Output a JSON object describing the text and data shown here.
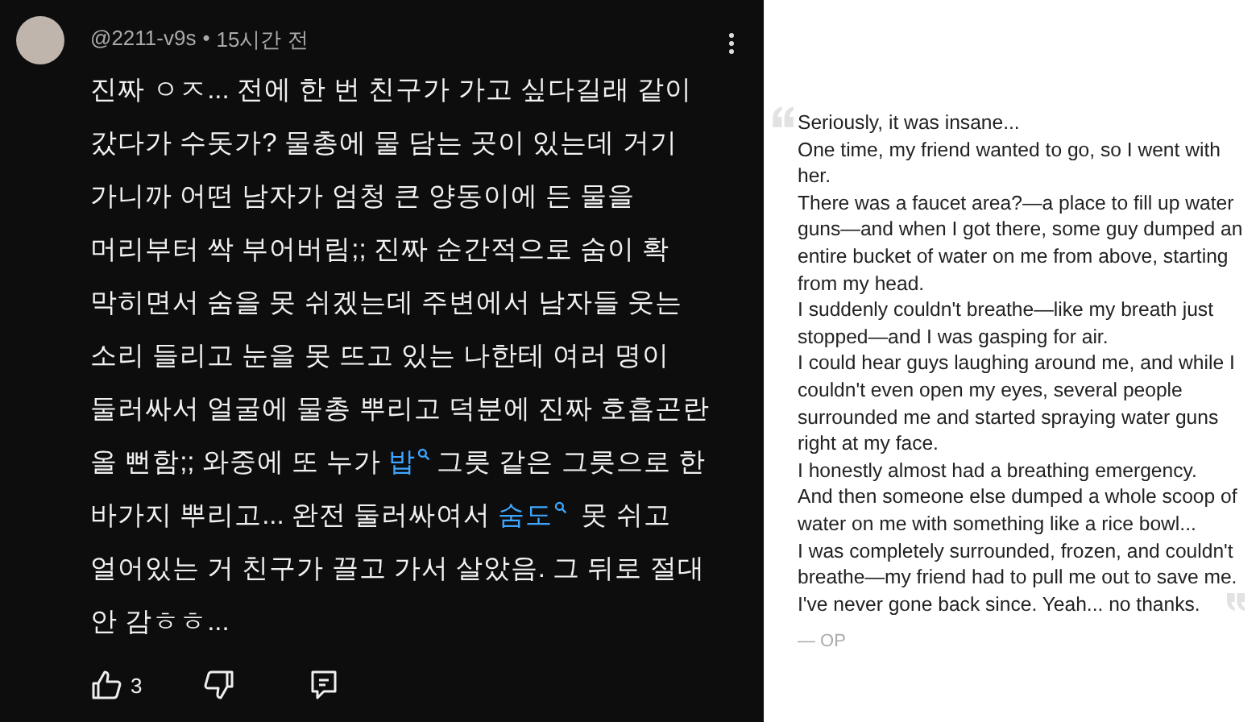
{
  "comment": {
    "author": "@2211-v9s",
    "separator": "•",
    "time": "15시간 전",
    "lines": [
      [
        {
          "kind": "plain",
          "text": "진짜 ㅇㅈ... 전에 한 번 친구가 가고 싶다길래 같이"
        }
      ],
      [
        {
          "kind": "plain",
          "text": "갔다가 수돗가? 물총에 물 담는 곳이 있는데 거기"
        }
      ],
      [
        {
          "kind": "plain",
          "text": "가니까 어떤 남자가 엄청 큰 양동이에 든 물을"
        }
      ],
      [
        {
          "kind": "plain",
          "text": "머리부터 싹 부어버림;; 진짜 순간적으로 숨이 확"
        }
      ],
      [
        {
          "kind": "plain",
          "text": "막히면서 숨을 못 쉬겠는데 주변에서 남자들 웃는"
        }
      ],
      [
        {
          "kind": "plain",
          "text": "소리 들리고 눈을 못 뜨고 있는 나한테 여러 명이"
        }
      ],
      [
        {
          "kind": "plain",
          "text": "둘러싸서 얼굴에 물총 뿌리고 덕분에 진짜 호흡곤란"
        }
      ],
      [
        {
          "kind": "plain",
          "text": "올 뻔함;; 와중에 또 누가 "
        },
        {
          "kind": "search_link",
          "text": "밥"
        },
        {
          "kind": "plain",
          "text": "그릇 같은 그릇으로 한"
        }
      ],
      [
        {
          "kind": "plain",
          "text": "바가지 뿌리고... 완전 둘러싸여서 "
        },
        {
          "kind": "search_link",
          "text": "숨도"
        },
        {
          "kind": "plain",
          "text": " 못 쉬고"
        }
      ],
      [
        {
          "kind": "plain",
          "text": "얼어있는 거 친구가 끌고 가서 살았음. 그 뒤로 절대"
        }
      ],
      [
        {
          "kind": "plain",
          "text": "안 감ㅎㅎ..."
        }
      ]
    ],
    "likes": "3"
  },
  "translation": {
    "paragraphs": [
      "Seriously, it was insane...",
      "One time, my friend wanted to go, so I went with her.",
      "There was a faucet area?—a place to fill up water guns—and when I got there, some guy dumped an entire bucket of water on me from above, starting from my head.",
      "I suddenly couldn't breathe—like my breath just stopped—and I was gasping for air.",
      "I could hear guys laughing around me, and while I couldn't even open my eyes, several people surrounded me and started spraying water guns right at my face.",
      "I honestly almost had a breathing emergency.",
      "And then someone else dumped a whole scoop of water on me with something like a rice bowl...",
      "I was completely surrounded, frozen, and couldn't breathe—my friend had to pull me out to save me.",
      "I've never gone back since. Yeah... no thanks."
    ],
    "attribution": "— OP"
  }
}
